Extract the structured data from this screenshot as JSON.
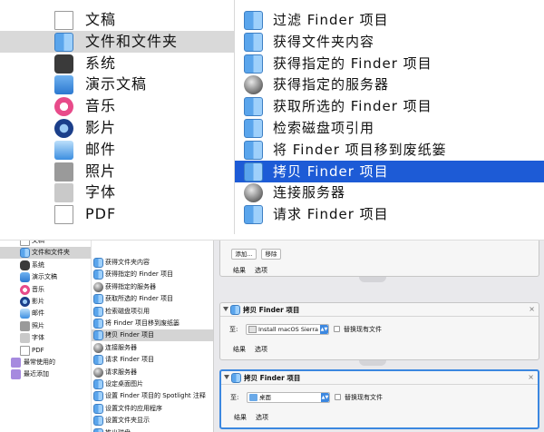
{
  "top": {
    "left_items": [
      {
        "label": "文稿",
        "icon": "document-icon"
      },
      {
        "label": "文件和文件夹",
        "icon": "finder-icon",
        "selected": true
      },
      {
        "label": "系统",
        "icon": "system-icon"
      },
      {
        "label": "演示文稿",
        "icon": "keynote-icon"
      },
      {
        "label": "音乐",
        "icon": "music-icon"
      },
      {
        "label": "影片",
        "icon": "quicktime-icon"
      },
      {
        "label": "邮件",
        "icon": "mail-icon"
      },
      {
        "label": "照片",
        "icon": "photos-icon"
      },
      {
        "label": "字体",
        "icon": "font-icon"
      },
      {
        "label": "PDF",
        "icon": "pdf-icon"
      }
    ],
    "right_items": [
      {
        "label": "过滤 Finder 项目",
        "icon": "finder-icon"
      },
      {
        "label": "获得文件夹内容",
        "icon": "finder-icon"
      },
      {
        "label": "获得指定的 Finder 项目",
        "icon": "finder-icon"
      },
      {
        "label": "获得指定的服务器",
        "icon": "network-globe-icon"
      },
      {
        "label": "获取所选的 Finder 项目",
        "icon": "finder-icon"
      },
      {
        "label": "检索磁盘项引用",
        "icon": "finder-icon"
      },
      {
        "label": "将 Finder 项目移到废纸篓",
        "icon": "finder-icon"
      },
      {
        "label": "拷贝 Finder 项目",
        "icon": "finder-icon",
        "selected": true
      },
      {
        "label": "连接服务器",
        "icon": "network-globe-icon"
      },
      {
        "label": "请求 Finder 项目",
        "icon": "finder-icon"
      }
    ]
  },
  "bottom": {
    "left_items": [
      {
        "label": "文稿",
        "icon": "document-icon"
      },
      {
        "label": "文件和文件夹",
        "icon": "finder-icon",
        "selected": true
      },
      {
        "label": "系统",
        "icon": "system-icon"
      },
      {
        "label": "演示文稿",
        "icon": "keynote-icon"
      },
      {
        "label": "音乐",
        "icon": "music-icon"
      },
      {
        "label": "影片",
        "icon": "quicktime-icon"
      },
      {
        "label": "邮件",
        "icon": "mail-icon"
      },
      {
        "label": "照片",
        "icon": "photos-icon"
      },
      {
        "label": "字体",
        "icon": "font-icon"
      },
      {
        "label": "PDF",
        "icon": "pdf-icon"
      },
      {
        "label": "最常使用的",
        "icon": "smart-folder-icon"
      },
      {
        "label": "最近添加",
        "icon": "smart-folder-icon"
      }
    ],
    "mid_items": [
      {
        "label": "获得文件夹内容",
        "icon": "finder-icon"
      },
      {
        "label": "获得指定的 Finder 项目",
        "icon": "finder-icon"
      },
      {
        "label": "获得指定的服务器",
        "icon": "network-globe-icon"
      },
      {
        "label": "获取所选的 Finder 项目",
        "icon": "finder-icon"
      },
      {
        "label": "检索磁盘项引用",
        "icon": "finder-icon"
      },
      {
        "label": "将 Finder 项目移到废纸篓",
        "icon": "finder-icon"
      },
      {
        "label": "拷贝 Finder 项目",
        "icon": "finder-icon",
        "selected": true
      },
      {
        "label": "连接服务器",
        "icon": "network-globe-icon"
      },
      {
        "label": "请求 Finder 项目",
        "icon": "finder-icon"
      },
      {
        "label": "请求服务器",
        "icon": "network-globe-icon"
      },
      {
        "label": "设定桌面图片",
        "icon": "finder-icon"
      },
      {
        "label": "设置 Finder 项目的 Spotlight 注释",
        "icon": "finder-icon"
      },
      {
        "label": "设置文件的应用程序",
        "icon": "finder-icon"
      },
      {
        "label": "设置文件夹显示",
        "icon": "finder-icon"
      },
      {
        "label": "推出磁盘",
        "icon": "finder-icon"
      }
    ],
    "workflow": {
      "top_card": {
        "add_button": "添加...",
        "remove_button": "移除",
        "tab_results": "结果",
        "tab_options": "选项"
      },
      "cards": [
        {
          "title": "拷贝 Finder 项目",
          "to_label": "至:",
          "destination": "Install macOS Sierra",
          "replace_label": "替换现有文件",
          "tab_results": "结果",
          "tab_options": "选项"
        },
        {
          "title": "拷贝 Finder 项目",
          "to_label": "至:",
          "destination": "桌面",
          "replace_label": "替换现有文件",
          "tab_results": "结果",
          "tab_options": "选项"
        }
      ],
      "close_glyph": "×"
    }
  },
  "colors": {
    "selection_blue": "#1d5bd6",
    "selection_gray": "#d9d9d9",
    "focus_ring": "#3b87e0"
  }
}
